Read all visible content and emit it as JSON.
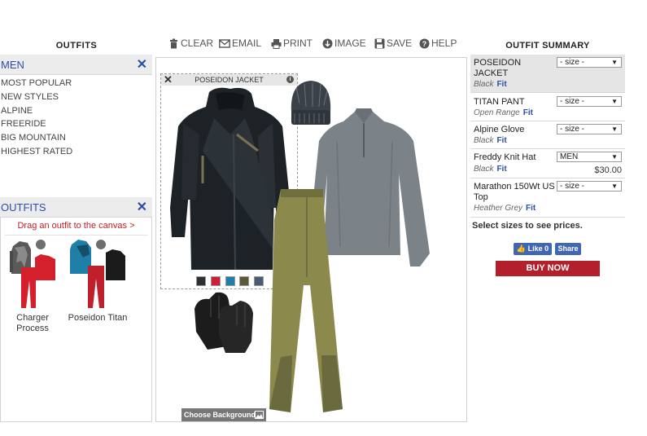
{
  "left": {
    "title": "OUTFITS",
    "category_panel": {
      "label": "MEN",
      "close": "✕"
    },
    "categories": [
      "MOST POPULAR",
      "NEW STYLES",
      "ALPINE",
      "FREERIDE",
      "BIG MOUNTAIN",
      "HIGHEST RATED"
    ],
    "outfits_panel": {
      "label": "OUTFITS",
      "close": "✕"
    },
    "drag_hint": "Drag an outfit to the canvas >",
    "outfits": [
      {
        "line1": "Charger",
        "line2": "Process"
      },
      {
        "line1": "Poseidon Titan",
        "line2": ""
      }
    ]
  },
  "toolbar": {
    "clear": "CLEAR",
    "email": "EMAIL",
    "print": "PRINT",
    "image": "IMAGE",
    "save": "SAVE",
    "help": "HELP"
  },
  "canvas": {
    "selected_item": "POSEIDON JACKET",
    "close": "✕",
    "info": "i",
    "swatch_colors": [
      "#2c3033",
      "#cc1f3a",
      "#1f7fa8",
      "#5b5a36",
      "#4a5c70"
    ],
    "choose_background": "Choose Background"
  },
  "summary": {
    "title": "OUTFIT SUMMARY",
    "items": [
      {
        "name": "POSEIDON JACKET",
        "color": "Black",
        "fit": "Fit",
        "size": "- size -",
        "price": ""
      },
      {
        "name": "TITAN PANT",
        "color": "Open Range",
        "fit": "Fit",
        "size": "- size -",
        "price": ""
      },
      {
        "name": "Alpine Glove",
        "color": "Black",
        "fit": "Fit",
        "size": "- size -",
        "price": ""
      },
      {
        "name": "Freddy Knit Hat",
        "color": "Black",
        "fit": "Fit",
        "size": "MEN",
        "price": "$30.00"
      },
      {
        "name": "Marathon 150Wt US Top",
        "color": "Heather Grey",
        "fit": "Fit",
        "size": "- size -",
        "price": ""
      }
    ],
    "select_sizes_note": "Select sizes to see prices.",
    "like": "Like 0",
    "share": "Share",
    "buy_now": "BUY NOW"
  }
}
